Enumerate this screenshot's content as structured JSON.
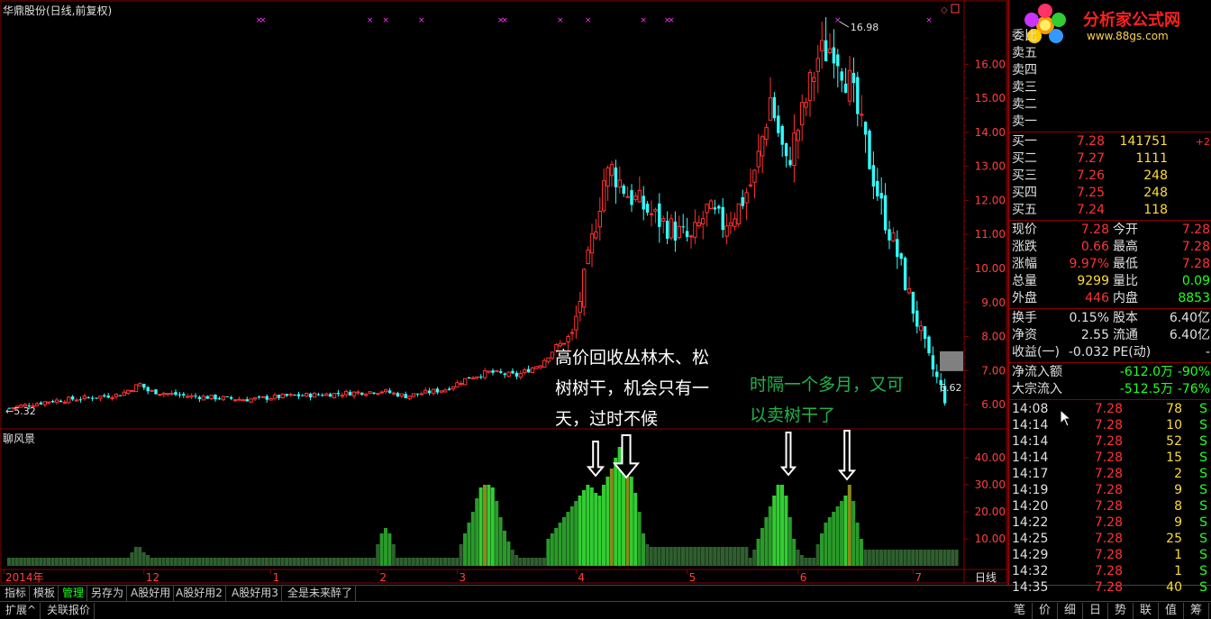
{
  "title": "华鼎股份(日线,前复权)",
  "indicator_title": "聊风景",
  "annotations": {
    "white": [
      "高价回收丛林木、松",
      "树树干，机会只有一",
      "天，过时不候"
    ],
    "green": [
      "时隔一个多月，又可",
      "以卖树干了"
    ]
  },
  "price_labels": {
    "low": "5.32",
    "high": "16.98",
    "last": "6.62"
  },
  "chart_data": [
    {
      "type": "candlestick",
      "title": "华鼎股份(日线,前复权)",
      "ylim": [
        5.5,
        17.2
      ],
      "yticks": [
        6,
        7,
        8,
        9,
        10,
        11,
        12,
        13,
        14,
        15,
        16
      ],
      "ytick_labels": [
        "6.00",
        "7.00",
        "8.00",
        "9.00",
        "10.00",
        "11.00",
        "12.00",
        "13.00",
        "14.00",
        "15.00",
        "16.00"
      ],
      "x_labels": [
        {
          "label": "2014年",
          "index": 0
        },
        {
          "label": "12",
          "index": 34
        },
        {
          "label": "1",
          "index": 66
        },
        {
          "label": "2",
          "index": 93
        },
        {
          "label": "3",
          "index": 113
        },
        {
          "label": "4",
          "index": 143
        },
        {
          "label": "5",
          "index": 171
        },
        {
          "label": "6",
          "index": 199
        },
        {
          "label": "7",
          "index": 228
        }
      ],
      "x_count": 240,
      "keyframes": [
        [
          0,
          5.9
        ],
        [
          10,
          6.1
        ],
        [
          20,
          6.2
        ],
        [
          28,
          6.3
        ],
        [
          33,
          6.6
        ],
        [
          35,
          6.4
        ],
        [
          45,
          6.25
        ],
        [
          60,
          6.15
        ],
        [
          70,
          6.25
        ],
        [
          80,
          6.3
        ],
        [
          94,
          6.4
        ],
        [
          100,
          6.25
        ],
        [
          110,
          6.45
        ],
        [
          116,
          6.8
        ],
        [
          121,
          6.95
        ],
        [
          128,
          6.85
        ],
        [
          134,
          7.2
        ],
        [
          138,
          7.7
        ],
        [
          142,
          8.0
        ],
        [
          146,
          10.2
        ],
        [
          150,
          12.6
        ],
        [
          152,
          12.9
        ],
        [
          156,
          12.2
        ],
        [
          164,
          11.4
        ],
        [
          172,
          10.8
        ],
        [
          176,
          11.7
        ],
        [
          180,
          11.3
        ],
        [
          184,
          11.8
        ],
        [
          188,
          12.7
        ],
        [
          192,
          15.0
        ],
        [
          196,
          13.0
        ],
        [
          200,
          14.5
        ],
        [
          204,
          16.2
        ],
        [
          208,
          16.6
        ],
        [
          212,
          15.4
        ],
        [
          216,
          13.6
        ],
        [
          220,
          11.8
        ],
        [
          224,
          10.4
        ],
        [
          228,
          8.8
        ],
        [
          232,
          7.3
        ],
        [
          236,
          6.2
        ]
      ],
      "markers_x": [
        63,
        64,
        91,
        95,
        104,
        124,
        125,
        139,
        146,
        160,
        166,
        167,
        209,
        232
      ]
    },
    {
      "type": "bar",
      "title": "聊风景",
      "ylim": [
        0,
        48
      ],
      "yticks": [
        10,
        20,
        30,
        40
      ],
      "ytick_labels": [
        "10.00",
        "20.00",
        "30.00",
        "40.00"
      ],
      "baseline": 3,
      "peaks": [
        {
          "start": 31,
          "end": 35,
          "values": [
            5,
            7,
            7,
            5,
            4
          ]
        },
        {
          "start": 93,
          "end": 97,
          "values": [
            8,
            12,
            14,
            12,
            8
          ]
        },
        {
          "start": 114,
          "end": 128,
          "values": [
            8,
            12,
            16,
            20,
            25,
            29,
            30,
            30,
            29,
            24,
            18,
            13,
            9,
            6,
            4
          ]
        },
        {
          "start": 136,
          "end": 161,
          "values": [
            10,
            12,
            14,
            16,
            18,
            20,
            22,
            24,
            26,
            28,
            30,
            29,
            27,
            26,
            30,
            33,
            36,
            40,
            44,
            43,
            38,
            33,
            27,
            20,
            12,
            8
          ]
        },
        {
          "start": 188,
          "end": 200,
          "values": [
            6,
            10,
            14,
            18,
            22,
            26,
            30,
            30,
            26,
            18,
            10,
            6,
            4
          ]
        },
        {
          "start": 204,
          "end": 216,
          "values": [
            8,
            12,
            16,
            18,
            20,
            22,
            24,
            26,
            30,
            24,
            16,
            10,
            6
          ]
        }
      ]
    }
  ],
  "bottom_tabs": [
    "指标",
    "模板",
    "管理",
    "另存为",
    "A股好用",
    "A股好用2",
    "A股好用3",
    "全是未来醉了"
  ],
  "bottom_tabs2": [
    "扩展^",
    "关联报价"
  ],
  "period_label": "日线",
  "logo": {
    "text": "分析家公式网",
    "url": "www.88gs.com"
  },
  "orderbook": {
    "weibi_label": "委比",
    "sell": [
      {
        "label": "卖五",
        "price": "",
        "vol": ""
      },
      {
        "label": "卖四",
        "price": "",
        "vol": ""
      },
      {
        "label": "卖三",
        "price": "",
        "vol": ""
      },
      {
        "label": "卖二",
        "price": "",
        "vol": ""
      },
      {
        "label": "卖一",
        "price": "",
        "vol": ""
      }
    ],
    "buy": [
      {
        "label": "买一",
        "price": "7.28",
        "vol": "141751",
        "chg": "+2"
      },
      {
        "label": "买二",
        "price": "7.27",
        "vol": "1111",
        "chg": ""
      },
      {
        "label": "买三",
        "price": "7.26",
        "vol": "248",
        "chg": ""
      },
      {
        "label": "买四",
        "price": "7.25",
        "vol": "248",
        "chg": ""
      },
      {
        "label": "买五",
        "price": "7.24",
        "vol": "118",
        "chg": ""
      }
    ]
  },
  "stats": [
    {
      "l1": "现价",
      "v1": "7.28",
      "c1": "red",
      "l2": "今开",
      "v2": "7.28",
      "c2": "red"
    },
    {
      "l1": "涨跌",
      "v1": "0.66",
      "c1": "red",
      "l2": "最高",
      "v2": "7.28",
      "c2": "red"
    },
    {
      "l1": "涨幅",
      "v1": "9.97%",
      "c1": "red",
      "l2": "最低",
      "v2": "7.28",
      "c2": "red"
    },
    {
      "l1": "总量",
      "v1": "9299",
      "c1": "yellow",
      "l2": "量比",
      "v2": "0.09",
      "c2": "green"
    },
    {
      "l1": "外盘",
      "v1": "446",
      "c1": "red",
      "l2": "内盘",
      "v2": "8853",
      "c2": "green"
    }
  ],
  "stats2": [
    {
      "l1": "换手",
      "v1": "0.15%",
      "c1": "white",
      "l2": "股本",
      "v2": "6.40亿",
      "c2": "white"
    },
    {
      "l1": "净资",
      "v1": "2.55",
      "c1": "white",
      "l2": "流通",
      "v2": "6.40亿",
      "c2": "white"
    },
    {
      "l1": "收益(一)",
      "v1": "-0.032",
      "c1": "white",
      "l2": "PE(动)",
      "v2": "-",
      "c2": "white"
    }
  ],
  "flows": [
    {
      "label": "净流入额",
      "value": "-612.0万",
      "pct": "-90%"
    },
    {
      "label": "大宗流入",
      "value": "-512.5万",
      "pct": "-76%"
    }
  ],
  "ticks": [
    {
      "time": "14:08",
      "price": "7.28",
      "vol": "78",
      "side": "S"
    },
    {
      "time": "14:14",
      "price": "7.28",
      "vol": "10",
      "side": "S"
    },
    {
      "time": "14:14",
      "price": "7.28",
      "vol": "52",
      "side": "S"
    },
    {
      "time": "14:14",
      "price": "7.28",
      "vol": "15",
      "side": "S"
    },
    {
      "time": "14:17",
      "price": "7.28",
      "vol": "2",
      "side": "S"
    },
    {
      "time": "14:19",
      "price": "7.28",
      "vol": "9",
      "side": "S"
    },
    {
      "time": "14:20",
      "price": "7.28",
      "vol": "8",
      "side": "S"
    },
    {
      "time": "14:22",
      "price": "7.28",
      "vol": "9",
      "side": "S"
    },
    {
      "time": "14:25",
      "price": "7.28",
      "vol": "25",
      "side": "S"
    },
    {
      "time": "14:29",
      "price": "7.28",
      "vol": "1",
      "side": "S"
    },
    {
      "time": "14:32",
      "price": "7.28",
      "vol": "1",
      "side": "S"
    },
    {
      "time": "14:35",
      "price": "7.28",
      "vol": "40",
      "side": "S"
    }
  ],
  "right_tabs": [
    "笔",
    "价",
    "细",
    "日",
    "势",
    "联",
    "值",
    "筹"
  ],
  "colors": {
    "up": "#ff3030",
    "down": "#33ffff",
    "frame": "#8b0000",
    "marker": "#ff33ff"
  }
}
